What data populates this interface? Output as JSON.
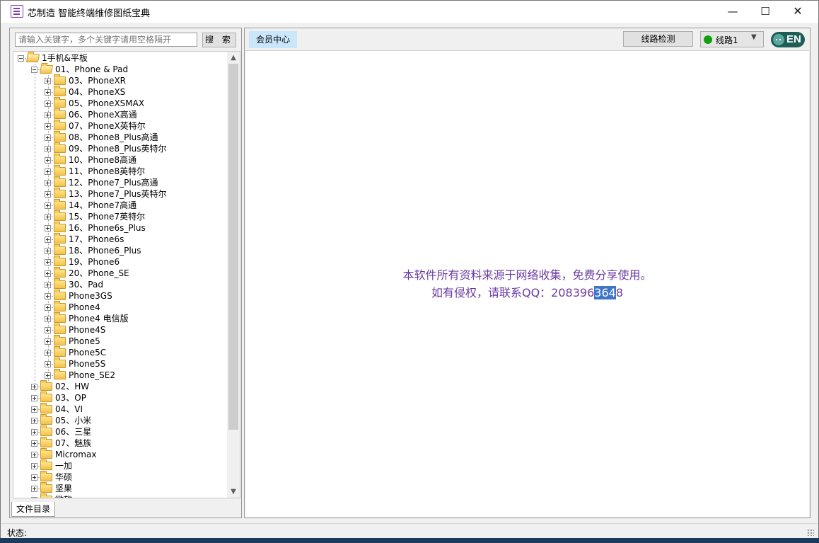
{
  "window": {
    "title": "芯制造 智能终端维修图纸宝典",
    "minimize_glyph": "—",
    "maximize_glyph": "☐",
    "close_glyph": "✕"
  },
  "sidebar": {
    "search_placeholder": "请输入关键字，多个关键字请用空格隔开",
    "search_button": "搜 索",
    "scroll_up_glyph": "▲",
    "scroll_down_glyph": "▼",
    "bottom_tab": "文件目录",
    "tree": [
      {
        "label": "1手机&平板",
        "level": 0,
        "state": "expanded"
      },
      {
        "label": "01、Phone & Pad",
        "level": 1,
        "state": "expanded"
      },
      {
        "label": "03、PhoneXR",
        "level": 2,
        "state": "collapsed"
      },
      {
        "label": "04、PhoneXS",
        "level": 2,
        "state": "collapsed"
      },
      {
        "label": "05、PhoneXSMAX",
        "level": 2,
        "state": "collapsed"
      },
      {
        "label": "06、PhoneX高通",
        "level": 2,
        "state": "collapsed"
      },
      {
        "label": "07、PhoneX英特尔",
        "level": 2,
        "state": "collapsed"
      },
      {
        "label": "08、Phone8_Plus高通",
        "level": 2,
        "state": "collapsed"
      },
      {
        "label": "09、Phone8_Plus英特尔",
        "level": 2,
        "state": "collapsed"
      },
      {
        "label": "10、Phone8高通",
        "level": 2,
        "state": "collapsed"
      },
      {
        "label": "11、Phone8英特尔",
        "level": 2,
        "state": "collapsed"
      },
      {
        "label": "12、Phone7_Plus高通",
        "level": 2,
        "state": "collapsed"
      },
      {
        "label": "13、Phone7_Plus英特尔",
        "level": 2,
        "state": "collapsed"
      },
      {
        "label": "14、Phone7高通",
        "level": 2,
        "state": "collapsed"
      },
      {
        "label": "15、Phone7英特尔",
        "level": 2,
        "state": "collapsed"
      },
      {
        "label": "16、Phone6s_Plus",
        "level": 2,
        "state": "collapsed"
      },
      {
        "label": "17、Phone6s",
        "level": 2,
        "state": "collapsed"
      },
      {
        "label": "18、Phone6_Plus",
        "level": 2,
        "state": "collapsed"
      },
      {
        "label": "19、Phone6",
        "level": 2,
        "state": "collapsed"
      },
      {
        "label": "20、Phone_SE",
        "level": 2,
        "state": "collapsed"
      },
      {
        "label": "30、Pad",
        "level": 2,
        "state": "collapsed"
      },
      {
        "label": "Phone3GS",
        "level": 2,
        "state": "collapsed"
      },
      {
        "label": "Phone4",
        "level": 2,
        "state": "collapsed"
      },
      {
        "label": "Phone4 电信版",
        "level": 2,
        "state": "collapsed"
      },
      {
        "label": "Phone4S",
        "level": 2,
        "state": "collapsed"
      },
      {
        "label": "Phone5",
        "level": 2,
        "state": "collapsed"
      },
      {
        "label": "Phone5C",
        "level": 2,
        "state": "collapsed"
      },
      {
        "label": "Phone5S",
        "level": 2,
        "state": "collapsed"
      },
      {
        "label": "Phone_SE2",
        "level": 2,
        "state": "collapsed"
      },
      {
        "label": "02、HW",
        "level": 1,
        "state": "collapsed"
      },
      {
        "label": "03、OP",
        "level": 1,
        "state": "collapsed"
      },
      {
        "label": "04、VI",
        "level": 1,
        "state": "collapsed"
      },
      {
        "label": "05、小米",
        "level": 1,
        "state": "collapsed"
      },
      {
        "label": "06、三星",
        "level": 1,
        "state": "collapsed"
      },
      {
        "label": "07、魅族",
        "level": 1,
        "state": "collapsed"
      },
      {
        "label": "Micromax",
        "level": 1,
        "state": "collapsed"
      },
      {
        "label": "一加",
        "level": 1,
        "state": "collapsed"
      },
      {
        "label": "华硕",
        "level": 1,
        "state": "collapsed"
      },
      {
        "label": "坚果",
        "level": 1,
        "state": "collapsed"
      },
      {
        "label": "微软",
        "level": 1,
        "state": "collapsed"
      }
    ]
  },
  "toolbar": {
    "member_tab": "会员中心",
    "line_check": "线路检测",
    "route_label": "线路1",
    "route_status_color": "#10a010",
    "route_arrow_glyph": "▼",
    "lang_button": "EN"
  },
  "content": {
    "notice_line1": "本软件所有资料来源于网络收集，免费分享使用。",
    "notice_line2_prefix": "如有侵权，请联系QQ：208396",
    "notice_line2_selected": "364",
    "notice_line2_suffix": "8"
  },
  "statusbar": {
    "text": "状态:"
  },
  "colors": {
    "notice_text": "#6b3ba3",
    "selection": "#3f76c8",
    "member_tab_bg": "#c9e6fb",
    "lang_button_bg": "#1e5e59"
  }
}
